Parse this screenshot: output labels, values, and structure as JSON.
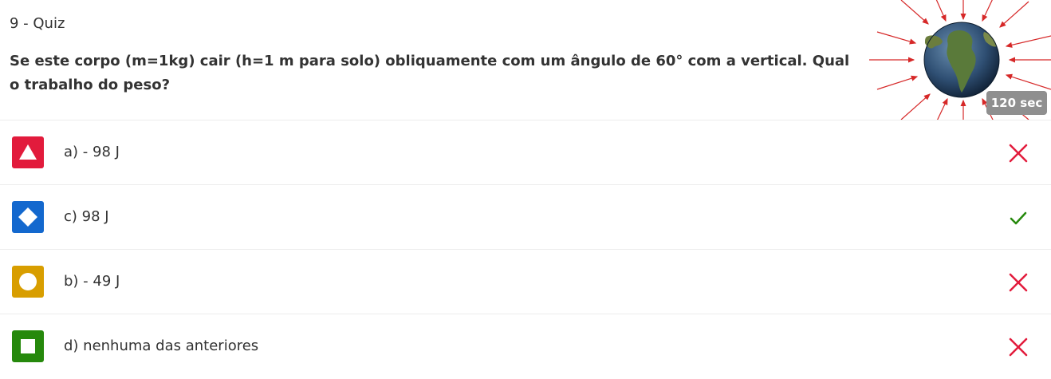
{
  "header": {
    "quiz_label": "9 - Quiz",
    "question": "Se este corpo (m=1kg) cair (h=1 m para solo) obliquamente com um ângulo de 60° com a vertical. Qual o trabalho do peso?",
    "image_icon": "earth-globe-gravity-field",
    "timer": "120 sec"
  },
  "options": [
    {
      "label": "a) - 98 J",
      "shape": "triangle",
      "color": "#e21b3c",
      "result": "incorrect"
    },
    {
      "label": "c) 98 J",
      "shape": "diamond",
      "color": "#1368ce",
      "result": "correct"
    },
    {
      "label": "b) - 49 J",
      "shape": "circle",
      "color": "#d89e00",
      "result": "incorrect"
    },
    {
      "label": "d) nenhuma das anteriores",
      "shape": "square",
      "color": "#26890c",
      "result": "incorrect"
    }
  ],
  "colors": {
    "incorrect": "#e21b3c",
    "correct": "#26890c",
    "timer_bg": "#8f8f8f"
  }
}
